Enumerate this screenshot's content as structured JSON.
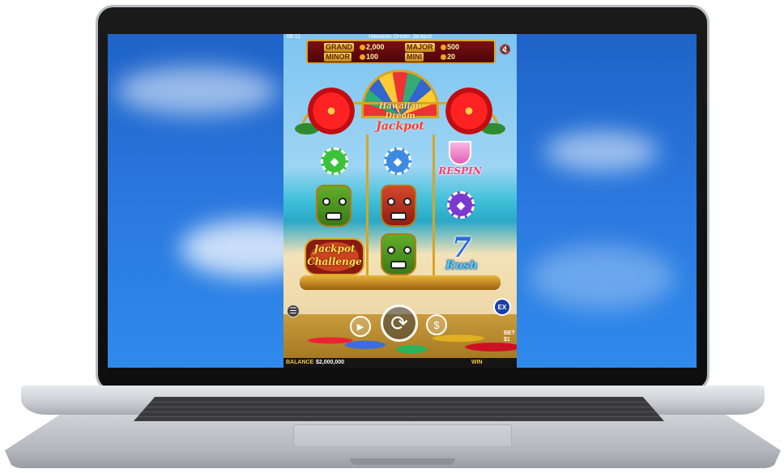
{
  "game": {
    "status": {
      "time": "08:11",
      "title": "Hawaiian Dream Jackpot"
    },
    "jackpots": [
      {
        "label": "GRAND",
        "value": "2,000"
      },
      {
        "label": "MAJOR",
        "value": "500"
      },
      {
        "label": "MINOR",
        "value": "100"
      },
      {
        "label": "MINI",
        "value": "20"
      }
    ],
    "logo": {
      "line1": "Hawaiian",
      "line2": "Dream",
      "line3": "Jackpot"
    },
    "symbols": {
      "respin": "RESPIN",
      "jackpot_challenge_1": "Jackpot",
      "jackpot_challenge_2": "Challenge",
      "seven_rush_digit": "7",
      "seven_rush_word": "Rush"
    },
    "buttons": {
      "ex_label": "EX",
      "ex_sub": "BET"
    },
    "bet": {
      "label": "BET",
      "value": "$1"
    },
    "info": {
      "balance_label": "BALANCE",
      "balance_value": "$2,000,000",
      "win_label": "WIN"
    }
  },
  "colors": {
    "sky": "#2b7ae0",
    "gold": "#d9a520",
    "jackpot_bg": "#7b0f12"
  }
}
